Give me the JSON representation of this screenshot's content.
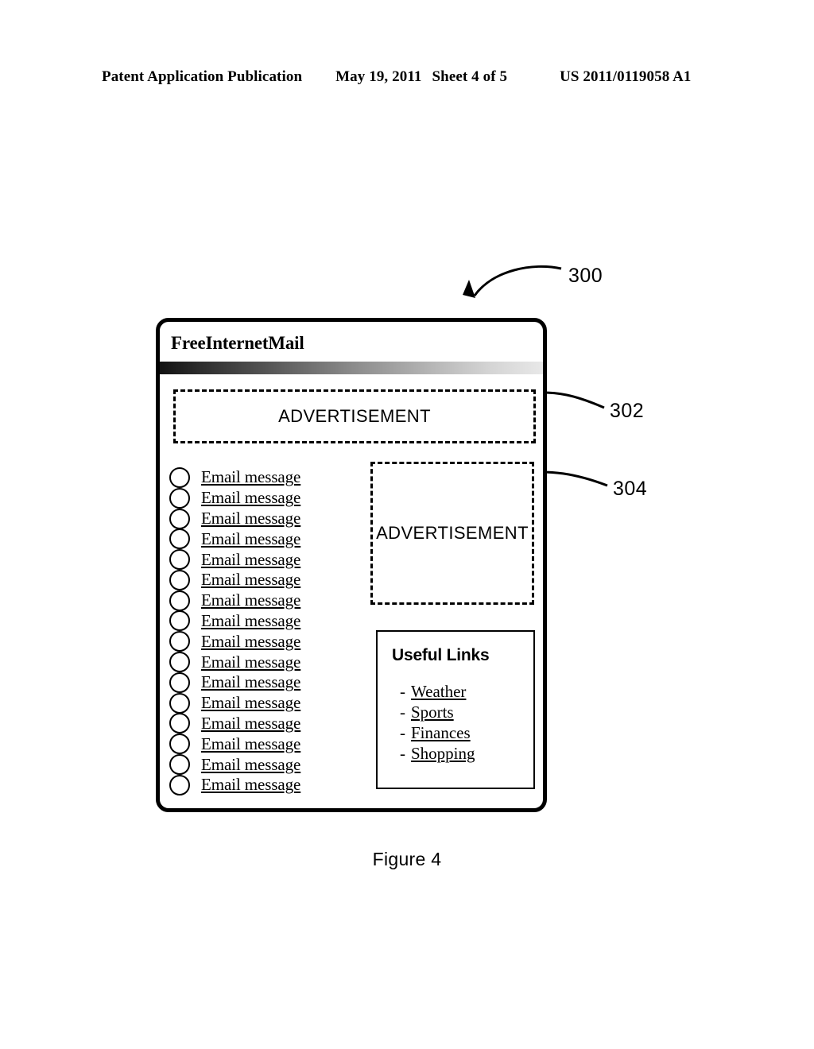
{
  "page_header": {
    "publication": "Patent Application Publication",
    "date": "May 19, 2011",
    "sheet": "Sheet 4 of 5",
    "publication_number": "US 2011/0119058 A1"
  },
  "figure": {
    "caption": "Figure 4"
  },
  "callouts": [
    {
      "id": "300",
      "label": "300",
      "target": "mail-window"
    },
    {
      "id": "302",
      "label": "302",
      "target": "banner-advertisement"
    },
    {
      "id": "304",
      "label": "304",
      "target": "sidebar-advertisement"
    }
  ],
  "mail_window": {
    "title": "FreeInternetMail",
    "banner_ad": {
      "label": "ADVERTISEMENT"
    },
    "sidebar_ad": {
      "label": "ADVERTISEMENT"
    },
    "email_list": {
      "items": [
        "Email message",
        "Email message",
        "Email message",
        "Email message",
        "Email message",
        "Email message",
        "Email message",
        "Email message",
        "Email message",
        "Email message",
        "Email message",
        "Email message",
        "Email message",
        "Email message",
        "Email message",
        "Email message"
      ]
    },
    "useful_links": {
      "title": "Useful Links",
      "bullet": "-",
      "items": [
        "Weather",
        "Sports",
        "Finances",
        "Shopping"
      ]
    }
  }
}
